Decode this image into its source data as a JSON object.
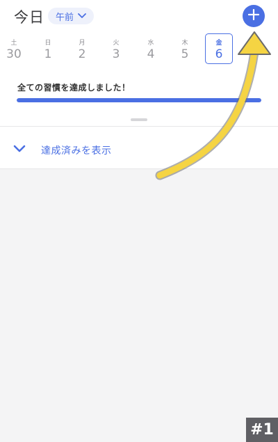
{
  "header": {
    "title": "今日",
    "period_label": "午前"
  },
  "week": [
    {
      "weekday": "土",
      "date": "30"
    },
    {
      "weekday": "日",
      "date": "1"
    },
    {
      "weekday": "月",
      "date": "2"
    },
    {
      "weekday": "火",
      "date": "3"
    },
    {
      "weekday": "水",
      "date": "4"
    },
    {
      "weekday": "木",
      "date": "5"
    },
    {
      "weekday": "金",
      "date": "6"
    }
  ],
  "selected_day_index": 6,
  "summary": {
    "message": "全ての習慣を達成しました！",
    "progress": 1.0
  },
  "completed_toggle": {
    "label": "達成済みを表示"
  },
  "overlay_badge": "#1",
  "colors": {
    "accent": "#4a6fe3",
    "annotation_arrow": "#f5d443"
  },
  "icons": {
    "add": "plus-icon",
    "period_dropdown": "chevron-down-icon",
    "toggle": "chevron-down-icon"
  }
}
